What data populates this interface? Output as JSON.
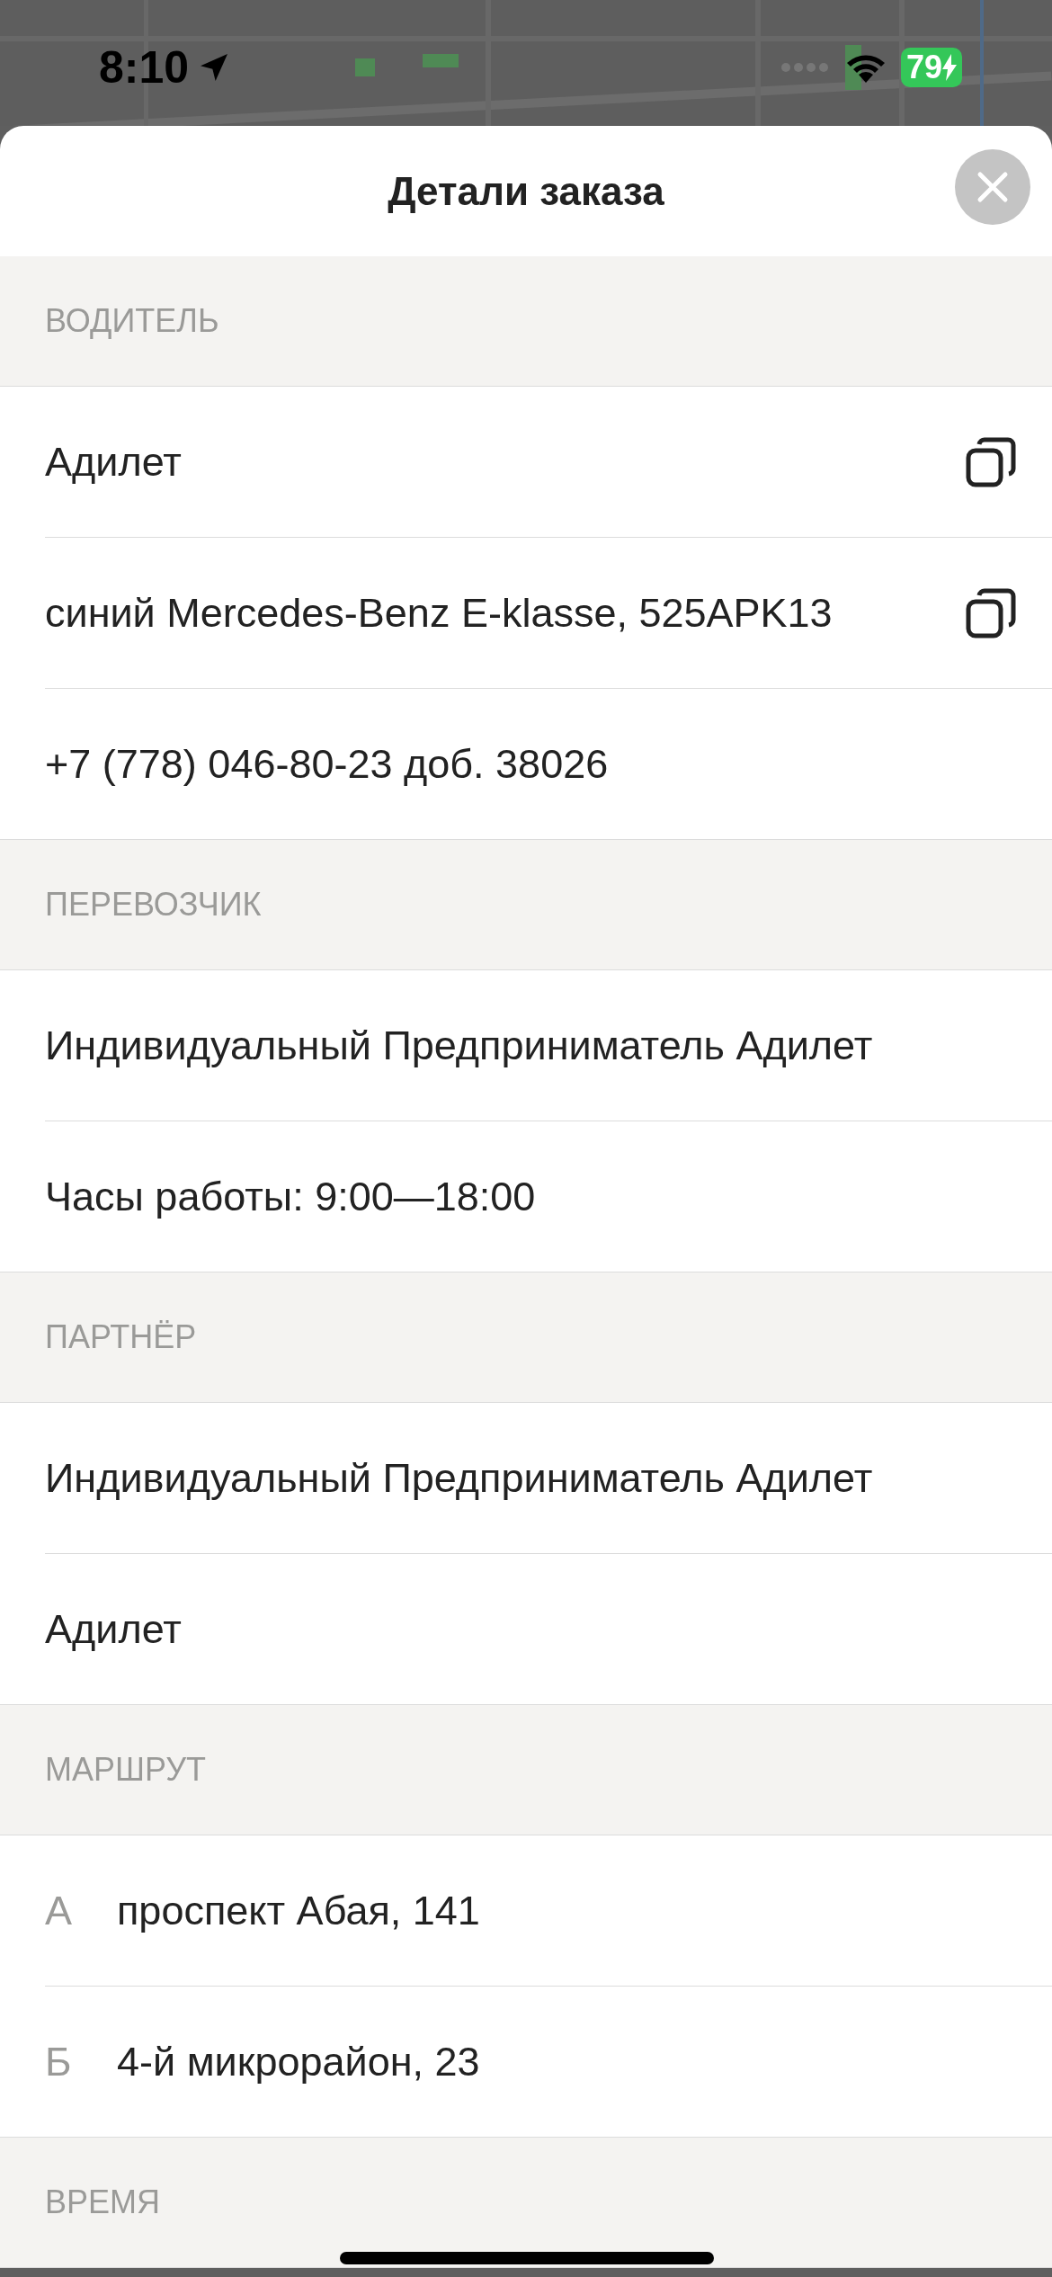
{
  "status_bar": {
    "time": "8:10",
    "battery": "79"
  },
  "sheet": {
    "title": "Детали заказа"
  },
  "sections": [
    {
      "title": "ВОДИТЕЛЬ",
      "items": [
        {
          "text": "Адилет",
          "copyable": true
        },
        {
          "text": "синий Mercedes-Benz E-klasse, 525APK13",
          "copyable": true
        },
        {
          "text": "+7 (778) 046-80-23 доб. 38026",
          "copyable": false
        }
      ]
    },
    {
      "title": "ПЕРЕВОЗЧИК",
      "items": [
        {
          "text": "Индивидуальный Предприниматель Адилет",
          "copyable": false
        },
        {
          "text": "Часы работы: 9:00—18:00",
          "copyable": false
        }
      ]
    },
    {
      "title": "ПАРТНЁР",
      "items": [
        {
          "text": "Индивидуальный Предприниматель Адилет",
          "copyable": false
        },
        {
          "text": "Адилет",
          "copyable": false
        }
      ]
    },
    {
      "title": "МАРШРУТ",
      "items": [
        {
          "marker": "А",
          "text": "проспект Абая, 141",
          "copyable": false
        },
        {
          "marker": "Б",
          "text": "4-й микрорайон, 23",
          "copyable": false
        }
      ]
    },
    {
      "title": "ВРЕМЯ"
    }
  ]
}
